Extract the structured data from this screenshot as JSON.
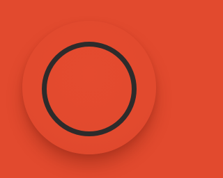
{
  "icon": {
    "semantic": "record-circle-icon",
    "colors": {
      "background": "#e24a2e",
      "button_face": "#e24a2e",
      "ring": "#2d2b2b",
      "shadow": "#7a1e0f"
    }
  }
}
